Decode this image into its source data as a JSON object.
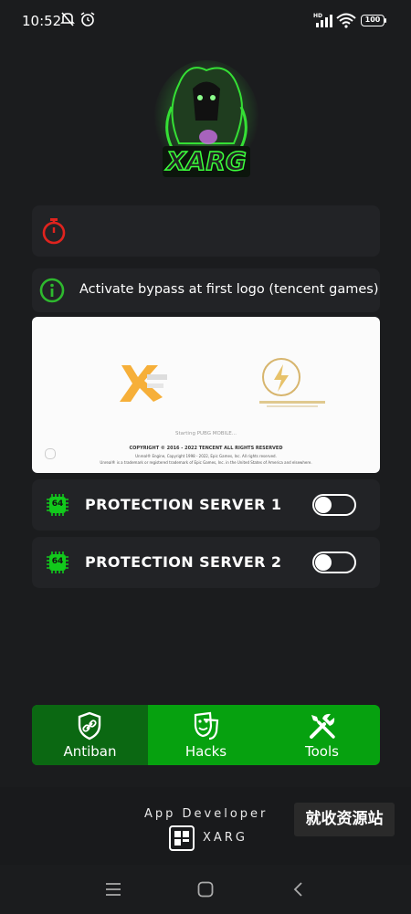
{
  "status_bar": {
    "time": "10:52",
    "network": "HD",
    "battery": "100"
  },
  "app": {
    "logo_text": "XARG"
  },
  "cards": {
    "timer_text": "",
    "info_text": "Activate bypass at first logo (tencent games)"
  },
  "preview": {
    "starting_text": "Starting PUBG MOBILE...",
    "copyright_1": "COPYRIGHT © 2016 - 2022 TENCENT ALL RIGHTS RESERVED",
    "copyright_2": "Unreal® Engine, Copyright 1998 - 2022, Epic Games, Inc. All rights reserved.",
    "copyright_3": "Unreal® is a trademark or registered trademark of Epic Games, Inc. in the United States of America and elsewhere."
  },
  "servers": [
    {
      "badge": "64",
      "label": "PROTECTION SERVER 1",
      "enabled": false
    },
    {
      "badge": "64",
      "label": "PROTECTION SERVER 2",
      "enabled": false
    }
  ],
  "bottom_nav": {
    "items": [
      {
        "label": "Antiban",
        "icon": "shield-link-icon",
        "active": true
      },
      {
        "label": "Hacks",
        "icon": "masks-icon",
        "active": false
      },
      {
        "label": "Tools",
        "icon": "tools-icon",
        "active": false
      }
    ]
  },
  "footer": {
    "title": "App Developer",
    "developer": "XARG",
    "watermark": "就收资源站"
  },
  "colors": {
    "accent_green": "#06a10f",
    "active_tab": "#0b6812",
    "timer_red": "#e0231e",
    "info_green": "#2eb82e",
    "badge_green": "#12c91c"
  }
}
